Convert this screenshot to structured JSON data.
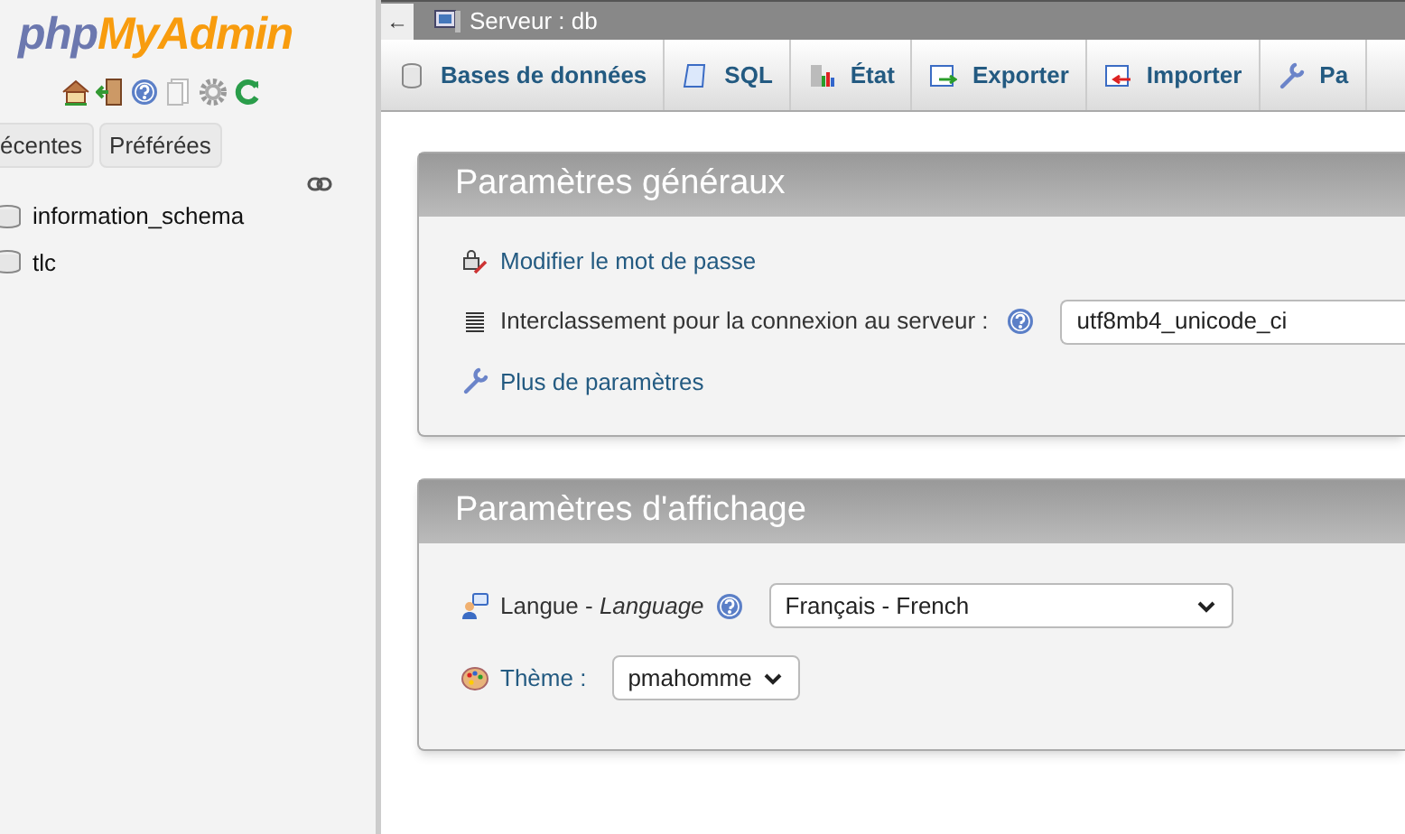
{
  "sidebar": {
    "logo": {
      "part_1": "php",
      "part_2": "MyAdmin"
    },
    "tabs": [
      {
        "label": "écentes",
        "selected": false
      },
      {
        "label": "Préférées",
        "selected": false
      }
    ],
    "databases": [
      {
        "name": "information_schema"
      },
      {
        "name": "tlc"
      }
    ]
  },
  "topbar": {
    "back": "←",
    "title": "Serveur : db"
  },
  "tabs": [
    {
      "label": "Bases de données"
    },
    {
      "label": "SQL"
    },
    {
      "label": "État"
    },
    {
      "label": "Exporter"
    },
    {
      "label": "Importer"
    },
    {
      "label": "Pa"
    }
  ],
  "panels": [
    {
      "title": "Paramètres généraux",
      "rows": [
        {
          "kind": "link",
          "label": "Modifier le mot de passe"
        },
        {
          "kind": "field",
          "label": "Interclassement pour la connexion au serveur :",
          "value": "utf8mb4_unicode_ci"
        },
        {
          "kind": "link",
          "label": "Plus de paramètres"
        }
      ]
    },
    {
      "title": "Paramètres d'affichage",
      "rows": [
        {
          "kind": "select",
          "label": "Langue - ",
          "label_italic": "Language",
          "value": "Français - French"
        },
        {
          "kind": "select",
          "label": "Thème :",
          "value": "pmahomme"
        }
      ]
    }
  ]
}
